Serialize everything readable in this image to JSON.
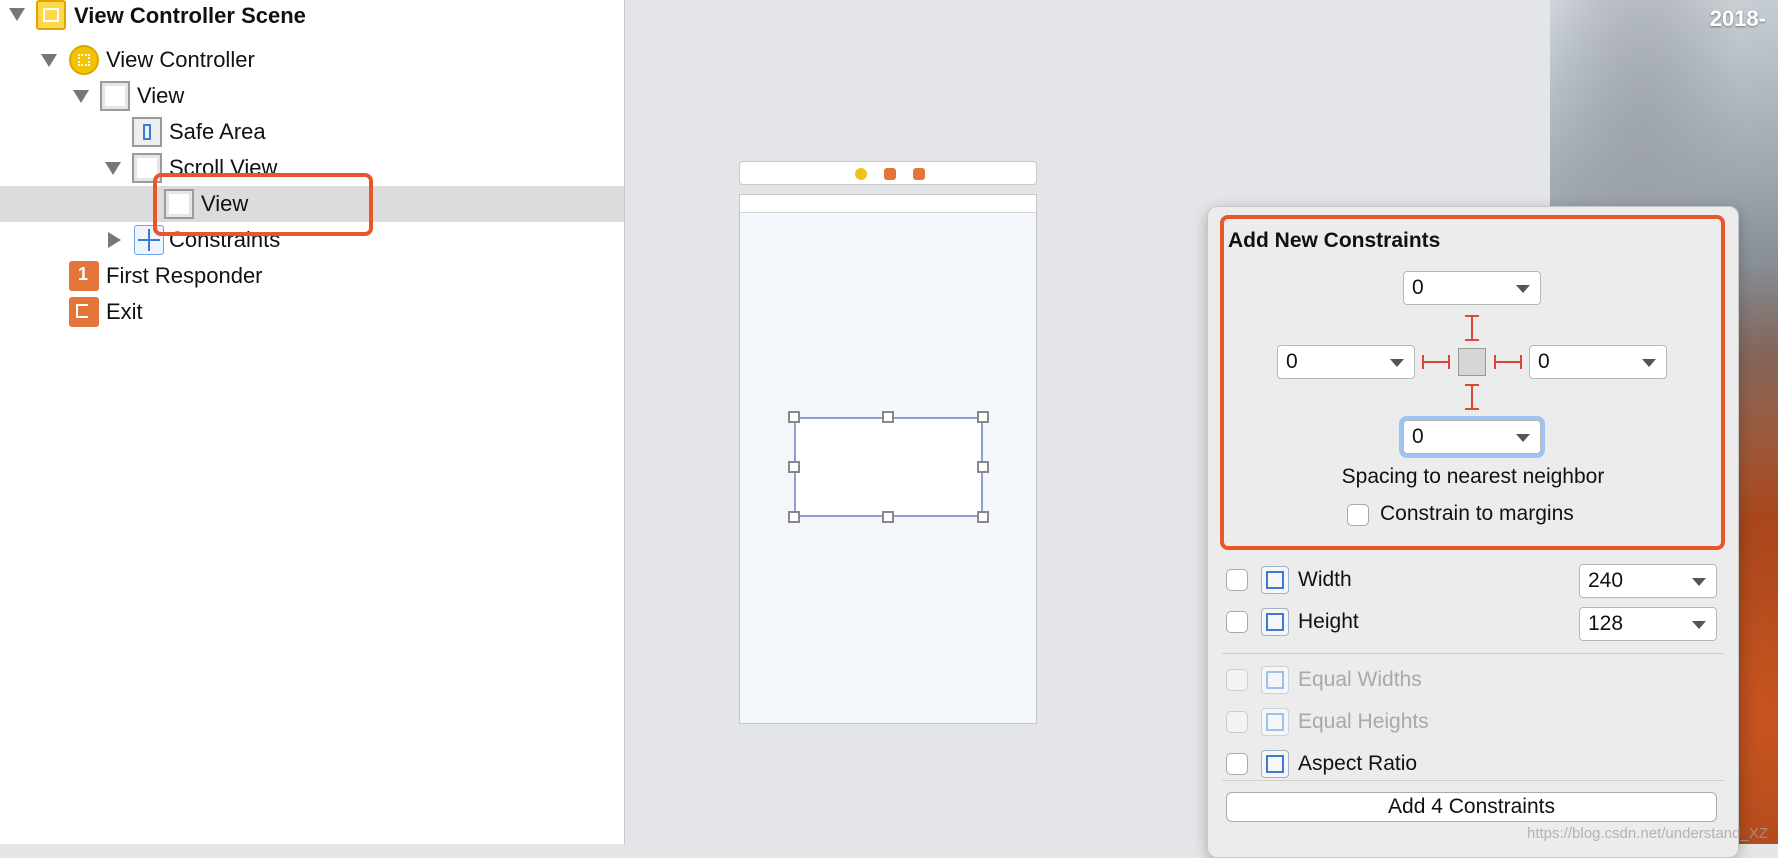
{
  "outline": {
    "scene_label": "View Controller Scene",
    "view_controller_label": "View Controller",
    "view_label": "View",
    "safe_area_label": "Safe Area",
    "scroll_view_label": "Scroll View",
    "content_view_label": "View",
    "constraints_label": "Constraints",
    "first_responder_label": "First Responder",
    "exit_label": "Exit",
    "icons": {
      "scene": "storyboard-scene-icon",
      "view_controller": "view-controller-icon",
      "view": "view-icon",
      "safe_area": "safe-area-icon",
      "scroll_view": "scroll-view-icon",
      "constraints": "constraints-icon",
      "first_responder": "first-responder-icon",
      "exit": "exit-icon"
    }
  },
  "desktop": {
    "clock": "2018-"
  },
  "popover": {
    "title": "Add New Constraints",
    "top_value": "0",
    "left_value": "0",
    "right_value": "0",
    "bottom_value": "0",
    "spacing_caption": "Spacing to nearest neighbor",
    "constrain_margins_label": "Constrain to margins",
    "width_label": "Width",
    "width_value": "240",
    "height_label": "Height",
    "height_value": "128",
    "equal_widths_label": "Equal Widths",
    "equal_heights_label": "Equal Heights",
    "aspect_ratio_label": "Aspect Ratio",
    "add_button_label": "Add 4 Constraints"
  },
  "watermark": "https://blog.csdn.net/understand_XZ",
  "colors": {
    "highlight": "#e8562a",
    "strut": "#d9463a",
    "focus_ring": "#9ec2f3",
    "selection_border": "#8f9fd3"
  }
}
